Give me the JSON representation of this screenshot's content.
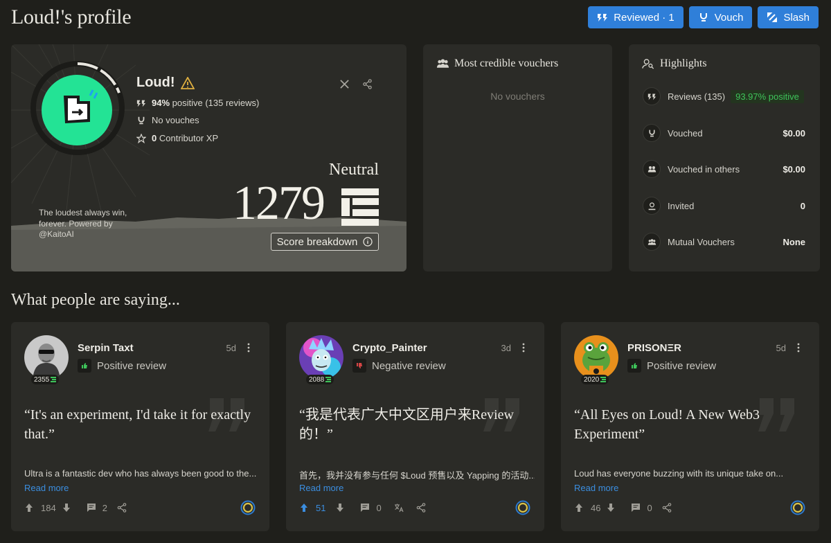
{
  "page": {
    "title": "Loud!'s profile"
  },
  "header": {
    "reviewed_label": "Reviewed · 1",
    "vouch_label": "Vouch",
    "slash_label": "Slash",
    "accent_color": "#2f7fd9"
  },
  "profile": {
    "name": "Loud!",
    "positive_pct": "94%",
    "positive_rest": "positive (135 reviews)",
    "vouches": "No vouches",
    "xp_value": "0",
    "xp_label": "Contributor XP",
    "tagline": "The loudest always win, forever. Powered by @KaitoAI",
    "level": "Neutral",
    "score": "1279",
    "breakdown_label": "Score breakdown",
    "avatar_color": "#23e395",
    "icons": [
      "x-icon",
      "share-icon",
      "warning-icon"
    ]
  },
  "vouchers": {
    "title": "Most credible vouchers",
    "empty": "No vouchers"
  },
  "highlights": {
    "title": "Highlights",
    "rows": [
      {
        "label": "Reviews (135)",
        "badge": "93.97% positive",
        "value": ""
      },
      {
        "label": "Vouched",
        "badge": "",
        "value": "$0.00"
      },
      {
        "label": "Vouched in others",
        "badge": "",
        "value": "$0.00"
      },
      {
        "label": "Invited",
        "badge": "",
        "value": "0"
      },
      {
        "label": "Mutual Vouchers",
        "badge": "",
        "value": "None"
      }
    ],
    "positive_color": "#3ec45a"
  },
  "reviews_section": {
    "title": "What people are saying..."
  },
  "reviews": [
    {
      "author": "Serpin Taxt",
      "score": "2355",
      "time": "5d",
      "sentiment": "Positive review",
      "quote": "“It's an experiment, I'd take it for exactly that.”",
      "body": "Ultra is a fantastic dev who has always been good to the...",
      "read_more": "Read more",
      "upvotes": "184",
      "comments": "2"
    },
    {
      "author": "Crypto_Painter",
      "score": "2088",
      "time": "3d",
      "sentiment": "Negative review",
      "quote": "“我是代表广大中文区用户来Review的！”",
      "body": "首先，我并没有参与任何 $Loud 预售以及 Yapping 的活动...",
      "read_more": "Read more",
      "upvotes": "51",
      "comments": "0"
    },
    {
      "author": "PRISONΞR",
      "score": "2020",
      "time": "5d",
      "sentiment": "Positive review",
      "quote": "“All Eyes on Loud! A New Web3 Experiment”",
      "body": "Loud has everyone buzzing with its unique take on...",
      "read_more": "Read more",
      "upvotes": "46",
      "comments": "0"
    }
  ]
}
